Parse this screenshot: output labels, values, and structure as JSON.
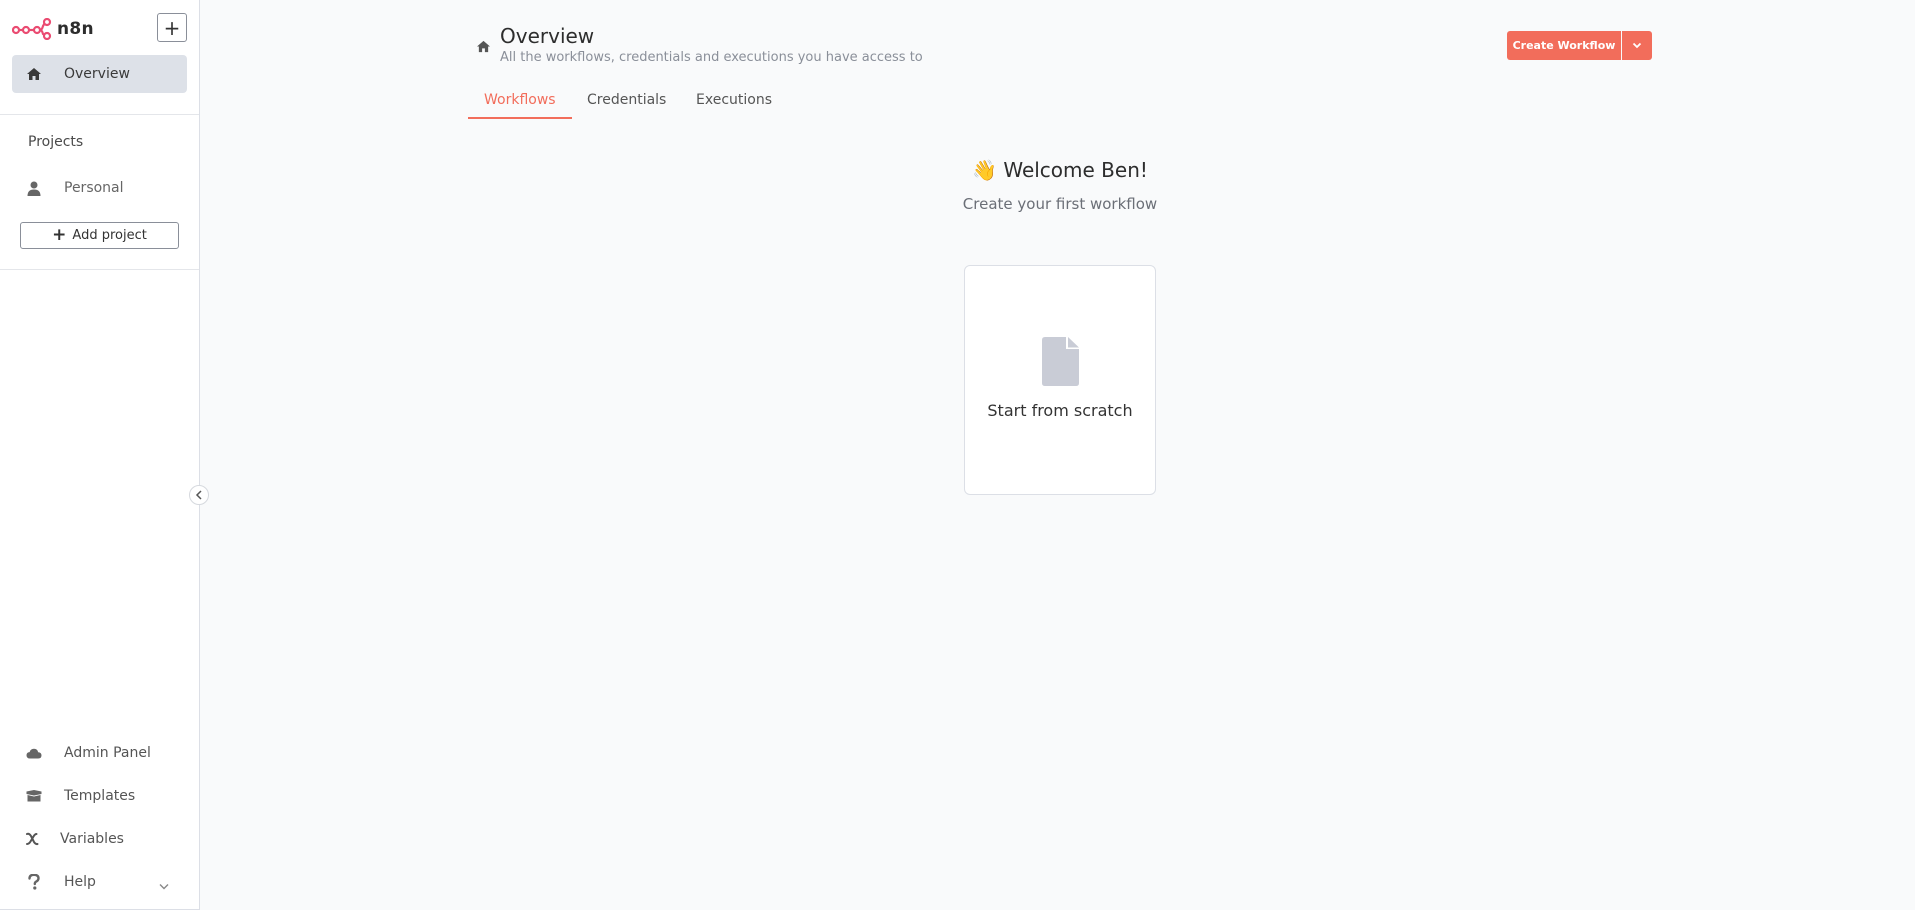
{
  "app": {
    "name": "n8n",
    "brand_color": "#ea4b71",
    "accent_color": "#f26d5b"
  },
  "sidebar": {
    "overview_label": "Overview",
    "projects_title": "Projects",
    "personal_label": "Personal",
    "add_project_label": "Add project",
    "bottom_items": [
      {
        "label": "Admin Panel",
        "icon": "cloud-icon"
      },
      {
        "label": "Templates",
        "icon": "box-icon"
      },
      {
        "label": "Variables",
        "icon": "variable-icon"
      },
      {
        "label": "Help",
        "icon": "question-icon"
      }
    ]
  },
  "header": {
    "title": "Overview",
    "subtitle": "All the workflows, credentials and executions you have access to",
    "create_button": "Create Workflow"
  },
  "tabs": [
    {
      "label": "Workflows",
      "active": true
    },
    {
      "label": "Credentials",
      "active": false
    },
    {
      "label": "Executions",
      "active": false
    }
  ],
  "empty_state": {
    "emoji": "👋",
    "welcome": "Welcome Ben!",
    "subtitle": "Create your first workflow",
    "card_label": "Start from scratch"
  }
}
